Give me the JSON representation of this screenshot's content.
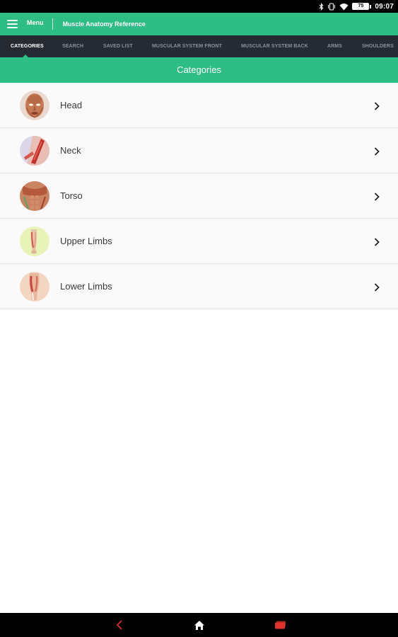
{
  "status_bar": {
    "battery": "75",
    "time": "09:07",
    "icons": [
      "bluetooth-icon",
      "vibrate-icon",
      "wifi-icon",
      "battery-icon"
    ]
  },
  "app_bar": {
    "menu_label": "Menu",
    "title": "Muscle Anatomy Reference",
    "accent_color": "#2fbd86"
  },
  "tabs": [
    {
      "label": "CATEGORIES",
      "active": true
    },
    {
      "label": "SEARCH",
      "active": false
    },
    {
      "label": "SAVED LIST",
      "active": false
    },
    {
      "label": "MUSCULAR SYSTEM FRONT",
      "active": false
    },
    {
      "label": "MUSCULAR SYSTEM BACK",
      "active": false
    },
    {
      "label": "ARMS",
      "active": false
    },
    {
      "label": "SHOULDERS",
      "active": false
    }
  ],
  "section": {
    "title": "Categories"
  },
  "categories": [
    {
      "label": "Head",
      "icon": "head-anatomy-icon"
    },
    {
      "label": "Neck",
      "icon": "neck-anatomy-icon"
    },
    {
      "label": "Torso",
      "icon": "torso-anatomy-icon"
    },
    {
      "label": "Upper Limbs",
      "icon": "upper-limbs-anatomy-icon"
    },
    {
      "label": "Lower Limbs",
      "icon": "lower-limbs-anatomy-icon"
    }
  ],
  "nav_bar": {
    "icons": [
      "back-icon",
      "home-icon",
      "recent-apps-icon"
    ]
  }
}
